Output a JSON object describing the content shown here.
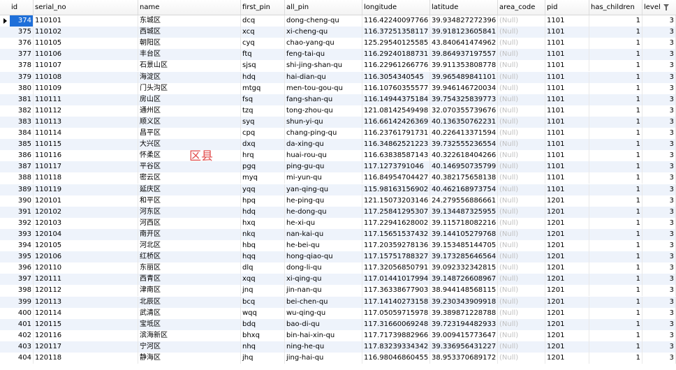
{
  "columns": [
    "id",
    "serial_no",
    "name",
    "first_pin",
    "all_pin",
    "longitude",
    "latitude",
    "area_code",
    "pid",
    "has_children",
    "level"
  ],
  "overlay_label": "区县",
  "rows": [
    [
      "374",
      "110101",
      "东城区",
      "dcq",
      "dong-cheng-qu",
      "116.42240097766",
      "39.934827272396",
      "(Null)",
      "1101",
      "1",
      "3"
    ],
    [
      "375",
      "110102",
      "西城区",
      "xcq",
      "xi-cheng-qu",
      "116.37251358117",
      "39.918123605841",
      "(Null)",
      "1101",
      "1",
      "3"
    ],
    [
      "376",
      "110105",
      "朝阳区",
      "cyq",
      "chao-yang-qu",
      "125.29540125585",
      "43.840641474962",
      "(Null)",
      "1101",
      "1",
      "3"
    ],
    [
      "377",
      "110106",
      "丰台区",
      "ftq",
      "feng-tai-qu",
      "116.29240188731",
      "39.864937197557",
      "(Null)",
      "1101",
      "1",
      "3"
    ],
    [
      "378",
      "110107",
      "石景山区",
      "sjsq",
      "shi-jing-shan-qu",
      "116.22961266776",
      "39.911353808778",
      "(Null)",
      "1101",
      "1",
      "3"
    ],
    [
      "379",
      "110108",
      "海淀区",
      "hdq",
      "hai-dian-qu",
      "116.3054340545",
      "39.965489841101",
      "(Null)",
      "1101",
      "1",
      "3"
    ],
    [
      "380",
      "110109",
      "门头沟区",
      "mtgq",
      "men-tou-gou-qu",
      "116.10760355577",
      "39.946146720034",
      "(Null)",
      "1101",
      "1",
      "3"
    ],
    [
      "381",
      "110111",
      "房山区",
      "fsq",
      "fang-shan-qu",
      "116.14944375184",
      "39.754325839773",
      "(Null)",
      "1101",
      "1",
      "3"
    ],
    [
      "382",
      "110112",
      "通州区",
      "tzq",
      "tong-zhou-qu",
      "121.08142549498",
      "32.070355739676",
      "(Null)",
      "1101",
      "1",
      "3"
    ],
    [
      "383",
      "110113",
      "顺义区",
      "syq",
      "shun-yi-qu",
      "116.66142426369",
      "40.136350762231",
      "(Null)",
      "1101",
      "1",
      "3"
    ],
    [
      "384",
      "110114",
      "昌平区",
      "cpq",
      "chang-ping-qu",
      "116.23761791731",
      "40.226413371594",
      "(Null)",
      "1101",
      "1",
      "3"
    ],
    [
      "385",
      "110115",
      "大兴区",
      "dxq",
      "da-xing-qu",
      "116.34862521223",
      "39.732555236554",
      "(Null)",
      "1101",
      "1",
      "3"
    ],
    [
      "386",
      "110116",
      "怀柔区",
      "hrq",
      "huai-rou-qu",
      "116.63838587143",
      "40.322618404266",
      "(Null)",
      "1101",
      "1",
      "3"
    ],
    [
      "387",
      "110117",
      "平谷区",
      "pgq",
      "ping-gu-qu",
      "117.1273791046",
      "40.146950735799",
      "(Null)",
      "1101",
      "1",
      "3"
    ],
    [
      "388",
      "110118",
      "密云区",
      "myq",
      "mi-yun-qu",
      "116.84954704427",
      "40.382175658138",
      "(Null)",
      "1101",
      "1",
      "3"
    ],
    [
      "389",
      "110119",
      "延庆区",
      "yqq",
      "yan-qing-qu",
      "115.98163156902",
      "40.462168973754",
      "(Null)",
      "1101",
      "1",
      "3"
    ],
    [
      "390",
      "120101",
      "和平区",
      "hpq",
      "he-ping-qu",
      "121.15073203146",
      "24.279556886661",
      "(Null)",
      "1201",
      "1",
      "3"
    ],
    [
      "391",
      "120102",
      "河东区",
      "hdq",
      "he-dong-qu",
      "117.25841295307",
      "39.134487325955",
      "(Null)",
      "1201",
      "1",
      "3"
    ],
    [
      "392",
      "120103",
      "河西区",
      "hxq",
      "he-xi-qu",
      "117.22941628002",
      "39.115718082216",
      "(Null)",
      "1201",
      "1",
      "3"
    ],
    [
      "393",
      "120104",
      "南开区",
      "nkq",
      "nan-kai-qu",
      "117.15651537432",
      "39.144105279768",
      "(Null)",
      "1201",
      "1",
      "3"
    ],
    [
      "394",
      "120105",
      "河北区",
      "hbq",
      "he-bei-qu",
      "117.20359278136",
      "39.153485144705",
      "(Null)",
      "1201",
      "1",
      "3"
    ],
    [
      "395",
      "120106",
      "红桥区",
      "hqq",
      "hong-qiao-qu",
      "117.15751788327",
      "39.173285646564",
      "(Null)",
      "1201",
      "1",
      "3"
    ],
    [
      "396",
      "120110",
      "东丽区",
      "dlq",
      "dong-li-qu",
      "117.32056850791",
      "39.092332342815",
      "(Null)",
      "1201",
      "1",
      "3"
    ],
    [
      "397",
      "120111",
      "西青区",
      "xqq",
      "xi-qing-qu",
      "117.01441017994",
      "39.148726608967",
      "(Null)",
      "1201",
      "1",
      "3"
    ],
    [
      "398",
      "120112",
      "津南区",
      "jnq",
      "jin-nan-qu",
      "117.36338677903",
      "38.944148568115",
      "(Null)",
      "1201",
      "1",
      "3"
    ],
    [
      "399",
      "120113",
      "北辰区",
      "bcq",
      "bei-chen-qu",
      "117.14140273158",
      "39.230343909918",
      "(Null)",
      "1201",
      "1",
      "3"
    ],
    [
      "400",
      "120114",
      "武清区",
      "wqq",
      "wu-qing-qu",
      "117.05059715978",
      "39.389871228788",
      "(Null)",
      "1201",
      "1",
      "3"
    ],
    [
      "401",
      "120115",
      "宝坻区",
      "bdq",
      "bao-di-qu",
      "117.31660069248",
      "39.723194482933",
      "(Null)",
      "1201",
      "1",
      "3"
    ],
    [
      "402",
      "120116",
      "滨海新区",
      "bhxq",
      "bin-hai-xin-qu",
      "117.71739882966",
      "39.009415773647",
      "(Null)",
      "1201",
      "1",
      "3"
    ],
    [
      "403",
      "120117",
      "宁河区",
      "nhq",
      "ning-he-qu",
      "117.83239334342",
      "39.336956431227",
      "(Null)",
      "1201",
      "1",
      "3"
    ],
    [
      "404",
      "120118",
      "静海区",
      "jhq",
      "jing-hai-qu",
      "116.98046860455",
      "38.953370689172",
      "(Null)",
      "1201",
      "1",
      "3"
    ]
  ],
  "selected_row_index": 0,
  "colors": {
    "selection": "#1e6fd9",
    "stripe": "#eef3fb",
    "overlay_text": "#e04a4a",
    "null_text": "#c0c0c0"
  }
}
